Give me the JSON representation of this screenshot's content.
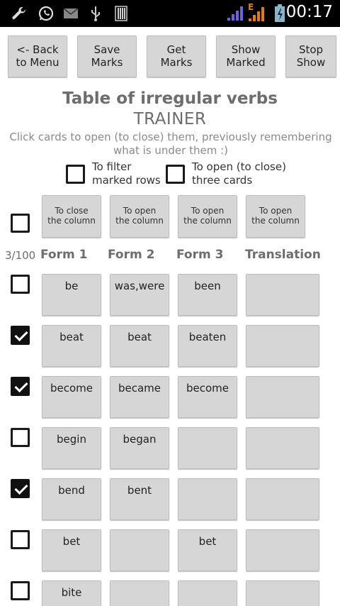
{
  "status": {
    "time": "00:17",
    "network_label": "E"
  },
  "toolbar": {
    "back": "<- Back\nto Menu",
    "save": "Save\nMarks",
    "get": "Get\nMarks",
    "show": "Show\nMarked",
    "stop": "Stop\nShow"
  },
  "header": {
    "title": "Table of irregular verbs",
    "subtitle": "TRAINER",
    "hint": "Click cards to open (to close) them, previously remembering what is under them :)"
  },
  "options": {
    "filter_label": "To filter\nmarked rows",
    "filter_checked": false,
    "open_three_label": "To open (to close)\nthree cards",
    "open_three_checked": false
  },
  "column_buttons": [
    "To close\nthe column",
    "To open\nthe column",
    "To open\nthe column",
    "To open\nthe column"
  ],
  "select_all_checked": false,
  "counter": "3/100",
  "columns": [
    "Form 1",
    "Form 2",
    "Form 3",
    "Translation"
  ],
  "rows": [
    {
      "checked": false,
      "cells": [
        "be",
        "was,were",
        "been",
        ""
      ]
    },
    {
      "checked": true,
      "cells": [
        "beat",
        "beat",
        "beaten",
        ""
      ]
    },
    {
      "checked": true,
      "cells": [
        "become",
        "became",
        "become",
        ""
      ]
    },
    {
      "checked": false,
      "cells": [
        "begin",
        "began",
        "",
        ""
      ]
    },
    {
      "checked": true,
      "cells": [
        "bend",
        "bent",
        "",
        ""
      ]
    },
    {
      "checked": false,
      "cells": [
        "bet",
        "",
        "bet",
        ""
      ]
    },
    {
      "checked": false,
      "cells": [
        "bite",
        "",
        "",
        ""
      ]
    }
  ]
}
